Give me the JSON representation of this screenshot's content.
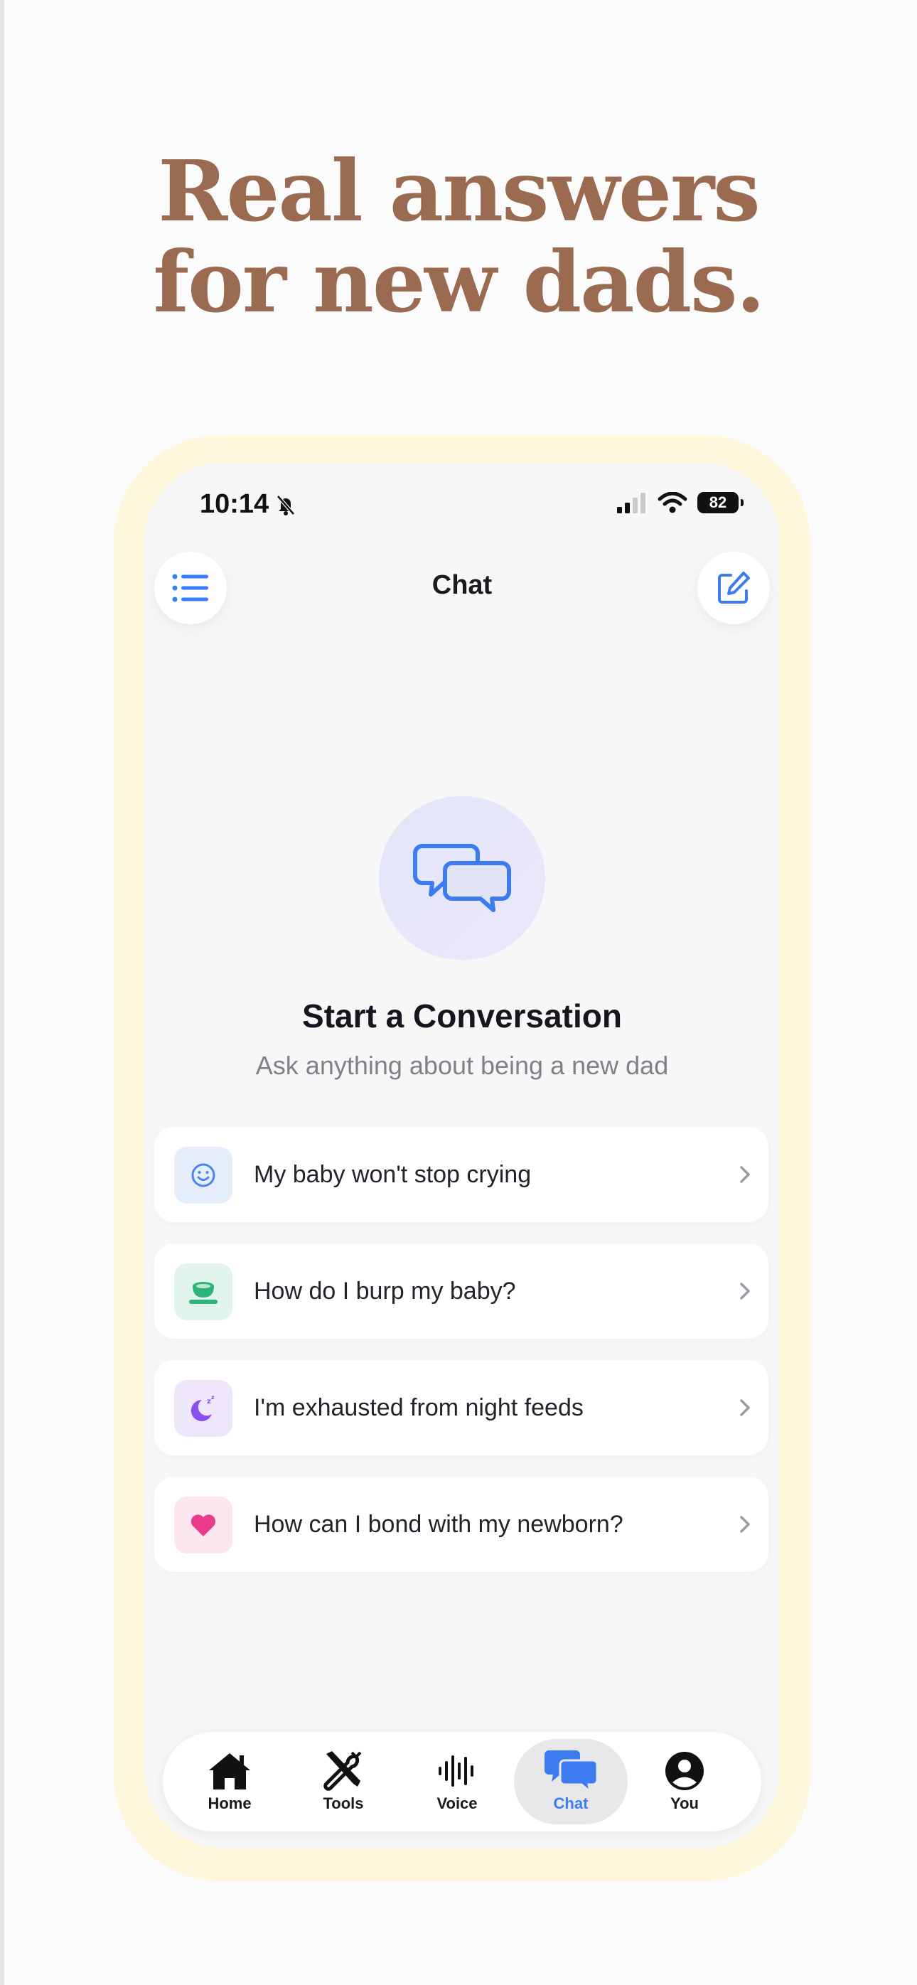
{
  "headline": {
    "line1": "Real answers",
    "line2": "for new dads."
  },
  "status_bar": {
    "time": "10:14",
    "battery": "82"
  },
  "nav": {
    "title": "Chat"
  },
  "hero": {
    "title": "Start a Conversation",
    "subtitle": "Ask anything about being a new dad"
  },
  "suggestions": [
    {
      "label": "My baby won't stop crying",
      "icon": "smiley-icon",
      "bg": "#e6eefc",
      "color": "#4a84f0"
    },
    {
      "label": "How do I burp my baby?",
      "icon": "cup-icon",
      "bg": "#e2f5ec",
      "color": "#2eb37a"
    },
    {
      "label": "I'm exhausted from night feeds",
      "icon": "moon-zzz-icon",
      "bg": "#eee6fb",
      "color": "#8a4ff0"
    },
    {
      "label": "How can I bond with my newborn?",
      "icon": "heart-icon",
      "bg": "#fce6f0",
      "color": "#ea3c8c"
    }
  ],
  "tabs": [
    {
      "label": "Home",
      "icon": "home-icon",
      "active": false
    },
    {
      "label": "Tools",
      "icon": "tools-icon",
      "active": false
    },
    {
      "label": "Voice",
      "icon": "waveform-icon",
      "active": false
    },
    {
      "label": "Chat",
      "icon": "chat-bubbles-icon",
      "active": true
    },
    {
      "label": "You",
      "icon": "person-icon",
      "active": false
    }
  ],
  "colors": {
    "accent": "#3d7cf0",
    "headline": "#9a6b50",
    "frame": "#fff7dc"
  }
}
